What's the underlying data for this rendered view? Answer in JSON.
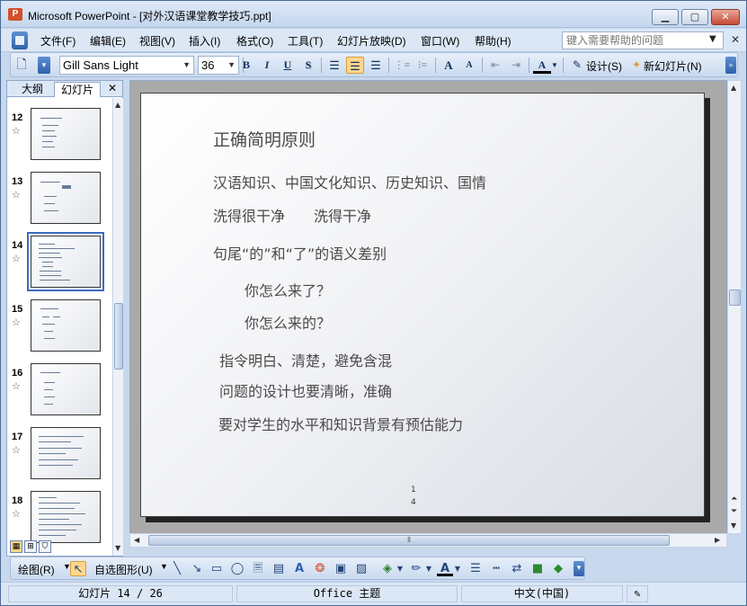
{
  "window": {
    "title": "Microsoft PowerPoint - [对外汉语课堂教学技巧.ppt]",
    "app_icon": "P",
    "minimize": "▁",
    "maximize": "▢",
    "close": "✕"
  },
  "menu": {
    "items": [
      "文件(F)",
      "编辑(E)",
      "视图(V)",
      "插入(I)",
      "格式(O)",
      "工具(T)",
      "幻灯片放映(D)",
      "窗口(W)",
      "帮助(H)"
    ],
    "help_placeholder": "键入需要帮助的问题",
    "close_doc": "✕"
  },
  "toolbar": {
    "font": "Gill Sans Light",
    "size": "36",
    "bold": "B",
    "italic": "I",
    "underline": "U",
    "shadow": "S",
    "grow_font": "A",
    "shrink_font": "A",
    "font_color": "A",
    "design_label": "设计(S)",
    "new_slide_label": "新幻灯片(N)"
  },
  "left_pane": {
    "tabs": [
      "大纲",
      "幻灯片"
    ],
    "close": "✕",
    "thumbnails": [
      {
        "num": "12",
        "star": "☆"
      },
      {
        "num": "13",
        "star": "☆"
      },
      {
        "num": "14",
        "star": "☆",
        "selected": true
      },
      {
        "num": "15",
        "star": "☆"
      },
      {
        "num": "16",
        "star": "☆"
      },
      {
        "num": "17",
        "star": "☆"
      },
      {
        "num": "18",
        "star": "☆"
      }
    ]
  },
  "slide": {
    "lines": [
      "正确简明原则",
      "汉语知识、中国文化知识、历史知识、国情",
      "洗得很干净　　洗得干净",
      "句尾“的”和“了”的语义差别",
      "你怎么来了？",
      "你怎么来的？",
      "指令明白、清楚，避免含混",
      "问题的设计也要清晰，准确",
      "要对学生的水平和知识背景有预估能力"
    ],
    "page_number_a": "1",
    "page_number_b": "4"
  },
  "draw_toolbar": {
    "draw_label": "绘图(R)",
    "autoshape_label": "自选图形(U)"
  },
  "status": {
    "slide_info": "幻灯片 14 / 26",
    "theme": "Office 主题",
    "language": "中文(中国)"
  }
}
